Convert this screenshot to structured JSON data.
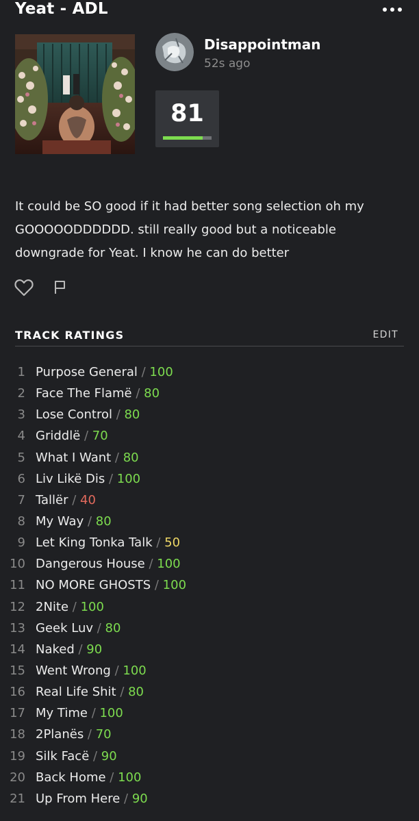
{
  "header": {
    "title": "Yeat - ADL",
    "more_icon": "more-horizontal-icon"
  },
  "review": {
    "album_art_alt": "Album cover",
    "user": {
      "name": "Disappointman",
      "time": "52s ago"
    },
    "score": {
      "value": "81",
      "fraction": 0.81,
      "bar_color": "#7ddc4f"
    },
    "text": "It could be SO good if it had better song selection oh my GOOOOODDDDDD. still really good but a noticeable downgrade for Yeat. I know he can do better",
    "actions": {
      "like_icon": "heart-icon",
      "flag_icon": "flag-icon"
    }
  },
  "track_ratings": {
    "title": "TRACK RATINGS",
    "edit_label": "EDIT",
    "separator": "/",
    "colors": {
      "green": "#7ddc4f",
      "red": "#e26a5d",
      "yellow": "#eed766"
    },
    "tracks": [
      {
        "num": "1",
        "name": "Purpose General",
        "rating": "100",
        "color": "green"
      },
      {
        "num": "2",
        "name": "Face The Flamë",
        "rating": "80",
        "color": "green"
      },
      {
        "num": "3",
        "name": "Lose Control",
        "rating": "80",
        "color": "green"
      },
      {
        "num": "4",
        "name": "Griddlë",
        "rating": "70",
        "color": "green"
      },
      {
        "num": "5",
        "name": "What I Want",
        "rating": "80",
        "color": "green"
      },
      {
        "num": "6",
        "name": "Liv Likë Dis",
        "rating": "100",
        "color": "green"
      },
      {
        "num": "7",
        "name": "Tallër",
        "rating": "40",
        "color": "red"
      },
      {
        "num": "8",
        "name": "My Way",
        "rating": "80",
        "color": "green"
      },
      {
        "num": "9",
        "name": "Let King Tonka Talk",
        "rating": "50",
        "color": "yellow"
      },
      {
        "num": "10",
        "name": "Dangerous House",
        "rating": "100",
        "color": "green"
      },
      {
        "num": "11",
        "name": "NO MORE GHOSTS",
        "rating": "100",
        "color": "green"
      },
      {
        "num": "12",
        "name": "2Nite",
        "rating": "100",
        "color": "green"
      },
      {
        "num": "13",
        "name": "Geek Luv",
        "rating": "80",
        "color": "green"
      },
      {
        "num": "14",
        "name": "Naked",
        "rating": "90",
        "color": "green"
      },
      {
        "num": "15",
        "name": "Went Wrong",
        "rating": "100",
        "color": "green"
      },
      {
        "num": "16",
        "name": "Real Life Shit",
        "rating": "80",
        "color": "green"
      },
      {
        "num": "17",
        "name": "My Time",
        "rating": "100",
        "color": "green"
      },
      {
        "num": "18",
        "name": "2Planës",
        "rating": "70",
        "color": "green"
      },
      {
        "num": "19",
        "name": "Silk Facë",
        "rating": "90",
        "color": "green"
      },
      {
        "num": "20",
        "name": "Back Home",
        "rating": "100",
        "color": "green"
      },
      {
        "num": "21",
        "name": "Up From Here",
        "rating": "90",
        "color": "green"
      }
    ]
  }
}
